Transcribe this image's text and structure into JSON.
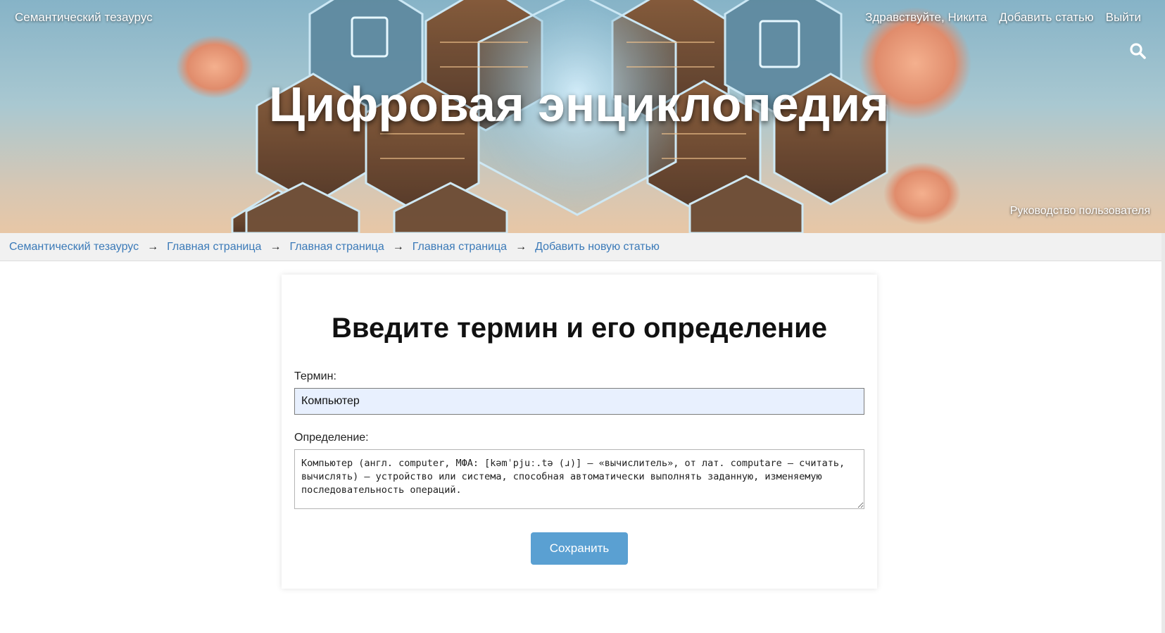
{
  "header": {
    "site_name": "Семантический тезаурус",
    "greeting": "Здравствуйте, Никита",
    "add_article": "Добавить статью",
    "logout": "Выйти",
    "title": "Цифровая энциклопедия",
    "guide": "Руководство пользователя"
  },
  "breadcrumb": {
    "items": [
      "Семантический тезаурус",
      "Главная страница",
      "Главная страница",
      "Главная страница",
      "Добавить новую статью"
    ],
    "separator": "→"
  },
  "form": {
    "heading": "Введите термин и его определение",
    "term_label": "Термин:",
    "term_value": "Компьютер",
    "definition_label": "Определение:",
    "definition_value": "Компьютер (англ. computer, МФА: [kəmˈpjuː.tə (ɹ)] — «вычислитель», от лат. computare — считать, вычислять) — устройство или система, способная автоматически выполнять заданную, изменяемую последовательность операций.",
    "save_label": "Сохранить"
  },
  "colors": {
    "link": "#3b7ab8",
    "button": "#5aa0d2",
    "input_fill": "#e8f0fe"
  },
  "icons": {
    "search": "search-icon"
  }
}
